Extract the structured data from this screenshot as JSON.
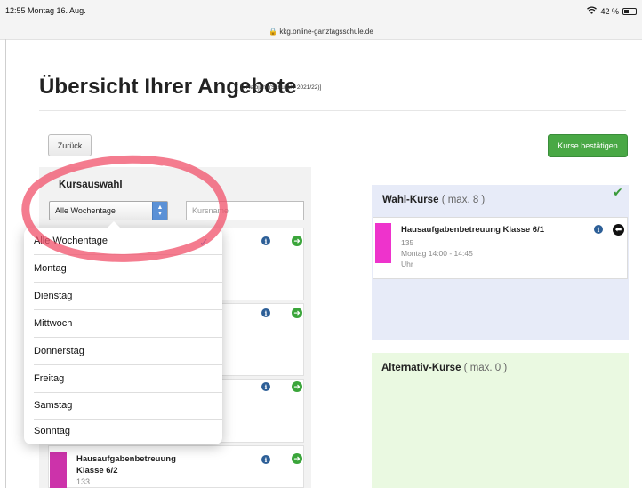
{
  "status_bar": {
    "time_date": "12:55  Montag 16. Aug.",
    "url": "kkg.online-ganztagsschule.de",
    "battery": "42 %",
    "battery_level": 0.42
  },
  "header": {
    "title": "Übersicht Ihrer Angebote",
    "subtitle": "[ 1. Halbjahr (Schuljahr 2021/22)]"
  },
  "buttons": {
    "back": "Zurück",
    "confirm": "Kurse bestätigen"
  },
  "filter": {
    "title": "Kursauswahl",
    "weekday_selected": "Alle Wochentage",
    "search_placeholder": "Kursname"
  },
  "dropdown": {
    "options": [
      "Alle Wochentage",
      "Montag",
      "Dienstag",
      "Mittwoch",
      "Donnerstag",
      "Freitag",
      "Samstag",
      "Sonntag"
    ],
    "selected_index": 0
  },
  "course_list": {
    "visible_card": {
      "title": "Hausaufgabenbetreuung Klasse 6/2",
      "room": "133"
    }
  },
  "wahl_kurse": {
    "title": "Wahl-Kurse",
    "max": "( max. 8 )",
    "course": {
      "title": "Hausaufgabenbetreuung Klasse 6/1",
      "room": "135",
      "time": "Montag 14:00 - 14:45",
      "unit": "Uhr"
    }
  },
  "alternativ_kurse": {
    "title": "Alternativ-Kurse",
    "max": "( max. 0 )"
  },
  "colors": {
    "confirm_button": "#49a845",
    "wahl_panel": "#e7ebf8",
    "alt_panel": "#eaf9e1",
    "course_swatch_1": "#ee33cc",
    "course_swatch_2": "#cc33aa",
    "annotation": "#f0506a"
  }
}
